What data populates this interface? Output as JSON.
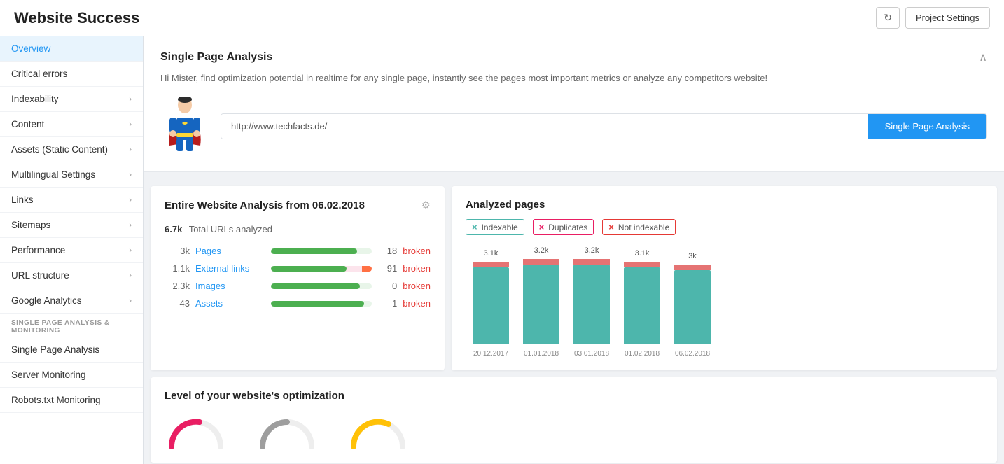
{
  "header": {
    "title": "Website Success",
    "refresh_label": "↻",
    "settings_label": "Project Settings"
  },
  "sidebar": {
    "items": [
      {
        "id": "overview",
        "label": "Overview",
        "active": true,
        "chevron": false
      },
      {
        "id": "critical-errors",
        "label": "Critical errors",
        "active": false,
        "chevron": false
      },
      {
        "id": "indexability",
        "label": "Indexability",
        "active": false,
        "chevron": true
      },
      {
        "id": "content",
        "label": "Content",
        "active": false,
        "chevron": true
      },
      {
        "id": "assets",
        "label": "Assets (Static Content)",
        "active": false,
        "chevron": true
      },
      {
        "id": "multilingual",
        "label": "Multilingual Settings",
        "active": false,
        "chevron": true
      },
      {
        "id": "links",
        "label": "Links",
        "active": false,
        "chevron": true
      },
      {
        "id": "sitemaps",
        "label": "Sitemaps",
        "active": false,
        "chevron": true
      },
      {
        "id": "performance",
        "label": "Performance",
        "active": false,
        "chevron": true
      },
      {
        "id": "url-structure",
        "label": "URL structure",
        "active": false,
        "chevron": true
      },
      {
        "id": "google-analytics",
        "label": "Google Analytics",
        "active": false,
        "chevron": true
      }
    ],
    "section_label": "SINGLE PAGE ANALYSIS & MONITORING",
    "sub_items": [
      {
        "id": "single-page-analysis",
        "label": "Single Page Analysis"
      },
      {
        "id": "server-monitoring",
        "label": "Server Monitoring"
      },
      {
        "id": "robots-monitoring",
        "label": "Robots.txt Monitoring"
      }
    ]
  },
  "single_page_analysis": {
    "title": "Single Page Analysis",
    "description": "Hi Mister, find optimization potential in realtime for any single page, instantly see the pages most important metrics or analyze any competitors website!",
    "input_value": "http://www.techfacts.de/",
    "input_placeholder": "http://www.techfacts.de/",
    "button_label": "Single Page Analysis"
  },
  "website_analysis": {
    "title": "Entire Website Analysis from 06.02.2018",
    "total_urls_num": "6.7k",
    "total_urls_label": "Total URLs analyzed",
    "stats": [
      {
        "num": "3k",
        "label": "Pages",
        "fill_pct": 85,
        "broken_num": "18",
        "broken_label": "broken",
        "bar_color": "#4caf50"
      },
      {
        "num": "1.1k",
        "label": "External links",
        "fill_pct": 75,
        "broken_num": "91",
        "broken_label": "broken",
        "bar_color": "#ff5722"
      },
      {
        "num": "2.3k",
        "label": "Images",
        "fill_pct": 88,
        "broken_num": "0",
        "broken_label": "broken",
        "bar_color": "#4caf50"
      },
      {
        "num": "43",
        "label": "Assets",
        "fill_pct": 92,
        "broken_num": "1",
        "broken_label": "broken",
        "bar_color": "#4caf50"
      }
    ]
  },
  "analyzed_pages": {
    "title": "Analyzed pages",
    "legend": [
      {
        "id": "indexable",
        "label": "Indexable",
        "color": "teal"
      },
      {
        "id": "duplicates",
        "label": "Duplicates",
        "color": "pink"
      },
      {
        "id": "not-indexable",
        "label": "Not indexable",
        "color": "red"
      }
    ],
    "bars": [
      {
        "date": "20.12.2017",
        "top_label": "3.1k",
        "height": 120
      },
      {
        "date": "01.01.2018",
        "top_label": "3.2k",
        "height": 124
      },
      {
        "date": "03.01.2018",
        "top_label": "3.2k",
        "height": 124
      },
      {
        "date": "01.02.2018",
        "top_label": "3.1k",
        "height": 120
      },
      {
        "date": "06.02.2018",
        "top_label": "3k",
        "height": 116
      }
    ]
  },
  "optimization_level": {
    "title": "Level of your website's optimization"
  }
}
